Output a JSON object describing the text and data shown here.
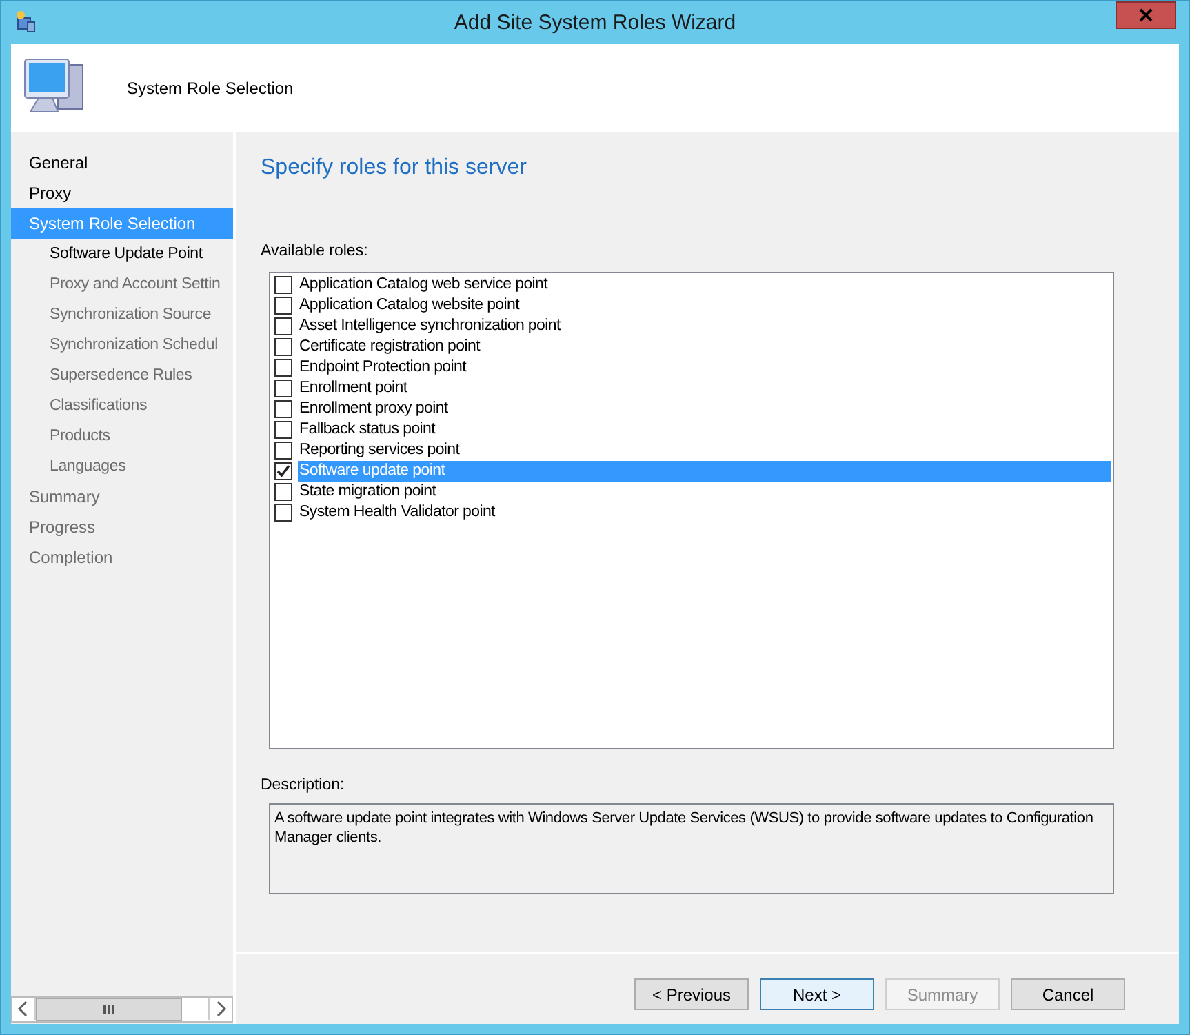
{
  "window": {
    "title": "Add Site System Roles Wizard"
  },
  "header": {
    "title": "System Role Selection"
  },
  "sidebar": {
    "items": [
      {
        "label": "General",
        "selected": false,
        "enabled": true
      },
      {
        "label": "Proxy",
        "selected": false,
        "enabled": true
      },
      {
        "label": "System Role Selection",
        "selected": true,
        "enabled": true,
        "children": [
          {
            "label": "Software Update Point",
            "selected": false,
            "enabled": true
          },
          {
            "label": "Proxy and Account Settin",
            "selected": false,
            "enabled": false
          },
          {
            "label": "Synchronization Source",
            "selected": false,
            "enabled": false
          },
          {
            "label": "Synchronization Schedul",
            "selected": false,
            "enabled": false
          },
          {
            "label": "Supersedence Rules",
            "selected": false,
            "enabled": false
          },
          {
            "label": "Classifications",
            "selected": false,
            "enabled": false
          },
          {
            "label": "Products",
            "selected": false,
            "enabled": false
          },
          {
            "label": "Languages",
            "selected": false,
            "enabled": false
          }
        ]
      },
      {
        "label": "Summary",
        "selected": false,
        "enabled": false
      },
      {
        "label": "Progress",
        "selected": false,
        "enabled": false
      },
      {
        "label": "Completion",
        "selected": false,
        "enabled": false
      }
    ]
  },
  "page": {
    "heading": "Specify roles for this server",
    "roles_label": "Available roles:",
    "roles": [
      {
        "label": "Application Catalog web service point",
        "checked": false,
        "selected": false
      },
      {
        "label": "Application Catalog website point",
        "checked": false,
        "selected": false
      },
      {
        "label": "Asset Intelligence synchronization point",
        "checked": false,
        "selected": false
      },
      {
        "label": "Certificate registration point",
        "checked": false,
        "selected": false
      },
      {
        "label": "Endpoint Protection point",
        "checked": false,
        "selected": false
      },
      {
        "label": "Enrollment point",
        "checked": false,
        "selected": false
      },
      {
        "label": "Enrollment proxy point",
        "checked": false,
        "selected": false
      },
      {
        "label": "Fallback status point",
        "checked": false,
        "selected": false
      },
      {
        "label": "Reporting services point",
        "checked": false,
        "selected": false
      },
      {
        "label": "Software update point",
        "checked": true,
        "selected": true
      },
      {
        "label": "State migration point",
        "checked": false,
        "selected": false
      },
      {
        "label": "System Health Validator point",
        "checked": false,
        "selected": false
      }
    ],
    "description_label": "Description:",
    "description": "A software update point integrates with Windows Server Update Services (WSUS) to provide software updates to Configuration Manager clients."
  },
  "buttons": [
    {
      "label": "< Previous",
      "enabled": true,
      "default": false
    },
    {
      "label": "Next >",
      "enabled": true,
      "default": true
    },
    {
      "label": "Summary",
      "enabled": false,
      "default": false
    },
    {
      "label": "Cancel",
      "enabled": true,
      "default": false
    }
  ]
}
